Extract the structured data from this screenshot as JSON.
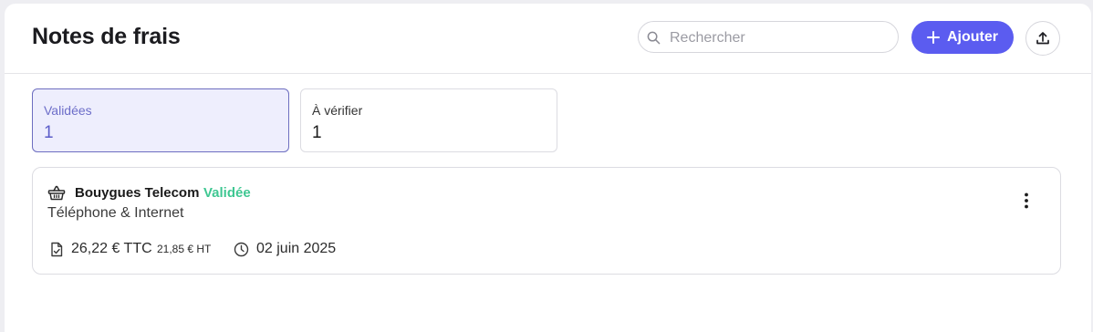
{
  "header": {
    "title": "Notes de frais",
    "search_placeholder": "Rechercher",
    "add_label": "Ajouter",
    "icons": {
      "search": "search-icon",
      "add": "plus-icon",
      "export": "upload-icon"
    }
  },
  "tabs": [
    {
      "label": "Validées",
      "count": "1",
      "active": true
    },
    {
      "label": "À vérifier",
      "count": "1",
      "active": false
    }
  ],
  "expense": {
    "merchant": "Bouygues Telecom",
    "status": "Validée",
    "category": "Téléphone & Internet",
    "amount_ttc": "26,22 € TTC",
    "amount_ht": "21,85 € HT",
    "date": "02 juin 2025",
    "icons": {
      "merchant": "basket-icon",
      "receipt": "receipt-check-icon",
      "date": "clock-icon",
      "menu": "more-vertical-icon"
    }
  },
  "colors": {
    "accent": "#5b5cf0",
    "status_validated": "#3fc792",
    "active_tab_bg": "#eeeefd"
  }
}
